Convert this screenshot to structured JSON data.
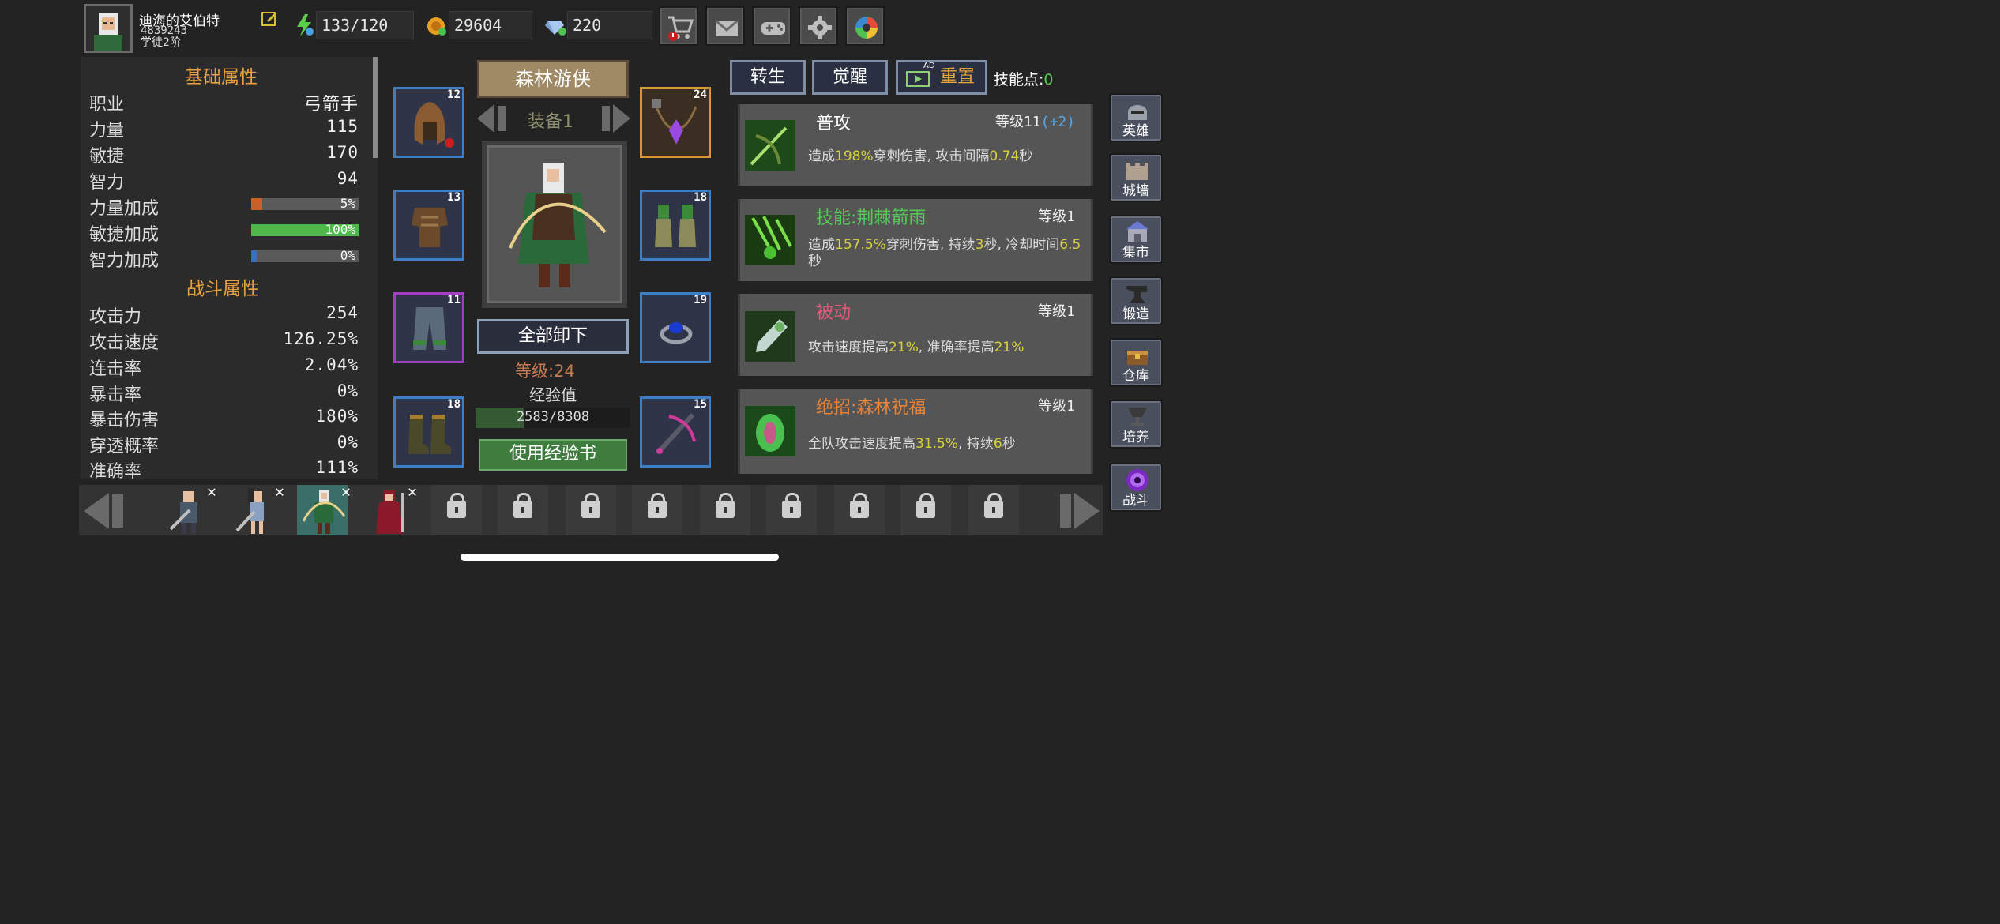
{
  "player": {
    "name": "迪海的艾伯特",
    "id": "4839243",
    "rank": "学徒2阶"
  },
  "resources": {
    "energy": "133/120",
    "gold": "29604",
    "diamond": "220"
  },
  "top_buttons": [
    "shop-cart-icon",
    "mail-icon",
    "gamepad-icon",
    "settings-gear-icon",
    "camera-aperture-icon"
  ],
  "base_attributes": {
    "title": "基础属性",
    "rows": [
      {
        "label": "职业",
        "value": "弓箭手"
      },
      {
        "label": "力量",
        "value": "115"
      },
      {
        "label": "敏捷",
        "value": "170"
      },
      {
        "label": "智力",
        "value": "94"
      }
    ],
    "bonuses": [
      {
        "label": "力量加成",
        "value": "5%",
        "fraction": 0.1,
        "color": "#c8602a"
      },
      {
        "label": "敏捷加成",
        "value": "100%",
        "fraction": 1.0,
        "color": "#4fb84a"
      },
      {
        "label": "智力加成",
        "value": "0%",
        "fraction": 0.05,
        "color": "#3a6fc0"
      }
    ]
  },
  "combat_attributes": {
    "title": "战斗属性",
    "rows": [
      {
        "label": "攻击力",
        "value": "254"
      },
      {
        "label": "攻击速度",
        "value": "126.25%"
      },
      {
        "label": "连击率",
        "value": "2.04%"
      },
      {
        "label": "暴击率",
        "value": "0%"
      },
      {
        "label": "暴击伤害",
        "value": "180%"
      },
      {
        "label": "穿透概率",
        "value": "0%"
      },
      {
        "label": "准确率",
        "value": "111%"
      }
    ]
  },
  "hero": {
    "class_title": "森林游侠",
    "equip_set": "装备1",
    "unequip_all": "全部卸下",
    "level": "等级:24",
    "exp_label": "经验值",
    "exp_text": "2583/8308",
    "exp_fraction": 0.311,
    "use_exp_book": "使用经验书"
  },
  "equipment": [
    {
      "slot": "helmet",
      "level": "12"
    },
    {
      "slot": "amulet",
      "level": "24"
    },
    {
      "slot": "armor",
      "level": "13"
    },
    {
      "slot": "gloves",
      "level": "18"
    },
    {
      "slot": "pants",
      "level": "11"
    },
    {
      "slot": "ring",
      "level": "19"
    },
    {
      "slot": "boots",
      "level": "18"
    },
    {
      "slot": "weapon",
      "level": "15"
    }
  ],
  "tabs": {
    "rebirth": "转生",
    "awaken": "觉醒",
    "reset": "重置",
    "ad_badge": "AD",
    "skill_points_label": "技能点:",
    "skill_points_value": "0"
  },
  "skills": [
    {
      "name": "普攻",
      "name_color": "#ffffff",
      "level": "等级11",
      "level_bonus": "(+2)",
      "desc": [
        {
          "t": "造成"
        },
        {
          "t": "198%",
          "h": 1
        },
        {
          "t": "穿刺伤害, 攻击间隔"
        },
        {
          "t": "0.74",
          "h": 1
        },
        {
          "t": "秒"
        }
      ]
    },
    {
      "name": "技能:荆棘箭雨",
      "name_color": "#55c855",
      "level": "等级1",
      "level_bonus": "",
      "desc": [
        {
          "t": "造成"
        },
        {
          "t": "157.5%",
          "h": 1
        },
        {
          "t": "穿刺伤害, 持续"
        },
        {
          "t": "3",
          "h": 1
        },
        {
          "t": "秒, 冷却时间"
        },
        {
          "t": "6.5",
          "h": 1
        },
        {
          "t": "秒"
        }
      ]
    },
    {
      "name": "被动",
      "name_color": "#e05a7a",
      "level": "等级1",
      "level_bonus": "",
      "desc": [
        {
          "t": "攻击速度提高"
        },
        {
          "t": "21%",
          "h": 1
        },
        {
          "t": ", 准确率提高"
        },
        {
          "t": "21%",
          "h": 1
        }
      ]
    },
    {
      "name": "绝招:森林祝福",
      "name_color": "#e8843a",
      "level": "等级1",
      "level_bonus": "",
      "desc": [
        {
          "t": "全队攻击速度提高"
        },
        {
          "t": "31.5%",
          "h": 1
        },
        {
          "t": ", 持续"
        },
        {
          "t": "6",
          "h": 1
        },
        {
          "t": "秒"
        }
      ]
    }
  ],
  "side_menu": [
    "英雄",
    "城墙",
    "集市",
    "锻造",
    "仓库",
    "培养",
    "战斗"
  ]
}
